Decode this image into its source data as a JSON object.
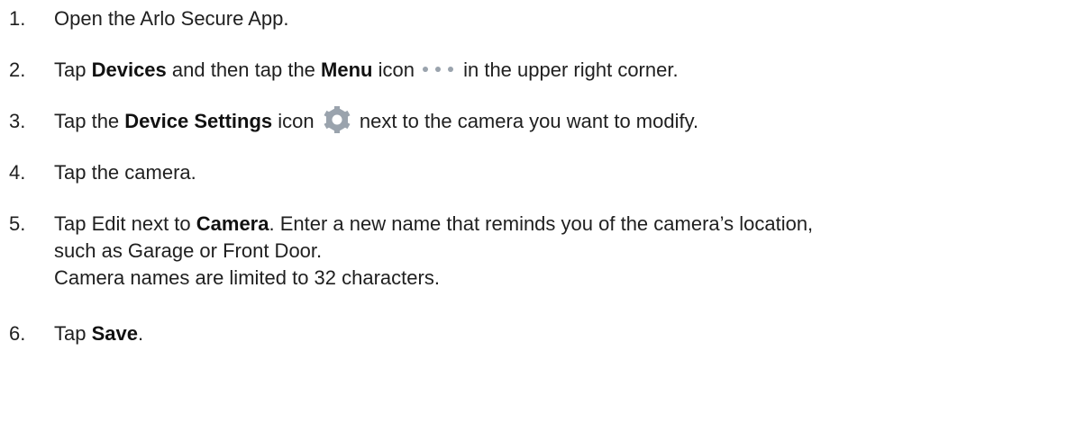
{
  "steps": [
    {
      "number": "1.",
      "parts": {
        "t1": "Open the Arlo Secure App."
      }
    },
    {
      "number": "2.",
      "parts": {
        "t1": "Tap ",
        "b1": "Devices",
        "t2": " and then tap the ",
        "b2": "Menu",
        "t3": " icon",
        "icon": "more-horizontal-dots-icon",
        "t4": " in the  upper right corner."
      }
    },
    {
      "number": "3.",
      "parts": {
        "t1": "Tap the ",
        "b1": "Device Settings",
        "t2": " icon",
        "icon": "gear-icon",
        "t3": " next to the camera you want to modify."
      }
    },
    {
      "number": "4.",
      "parts": {
        "t1": "Tap the camera."
      }
    },
    {
      "number": "5.",
      "parts": {
        "t1": "Tap Edit next to ",
        "b1": "Camera",
        "t2": ". Enter a new name that reminds you of the camera’s location,",
        "line2": "such as Garage or Front Door.",
        "line3": "Camera names are limited to 32 characters."
      }
    },
    {
      "number": "6.",
      "parts": {
        "t1": "Tap ",
        "b1": "Save",
        "t2": "."
      }
    }
  ],
  "colors": {
    "text": "#1f1f1f",
    "icon_gray": "#9aa3ad"
  }
}
